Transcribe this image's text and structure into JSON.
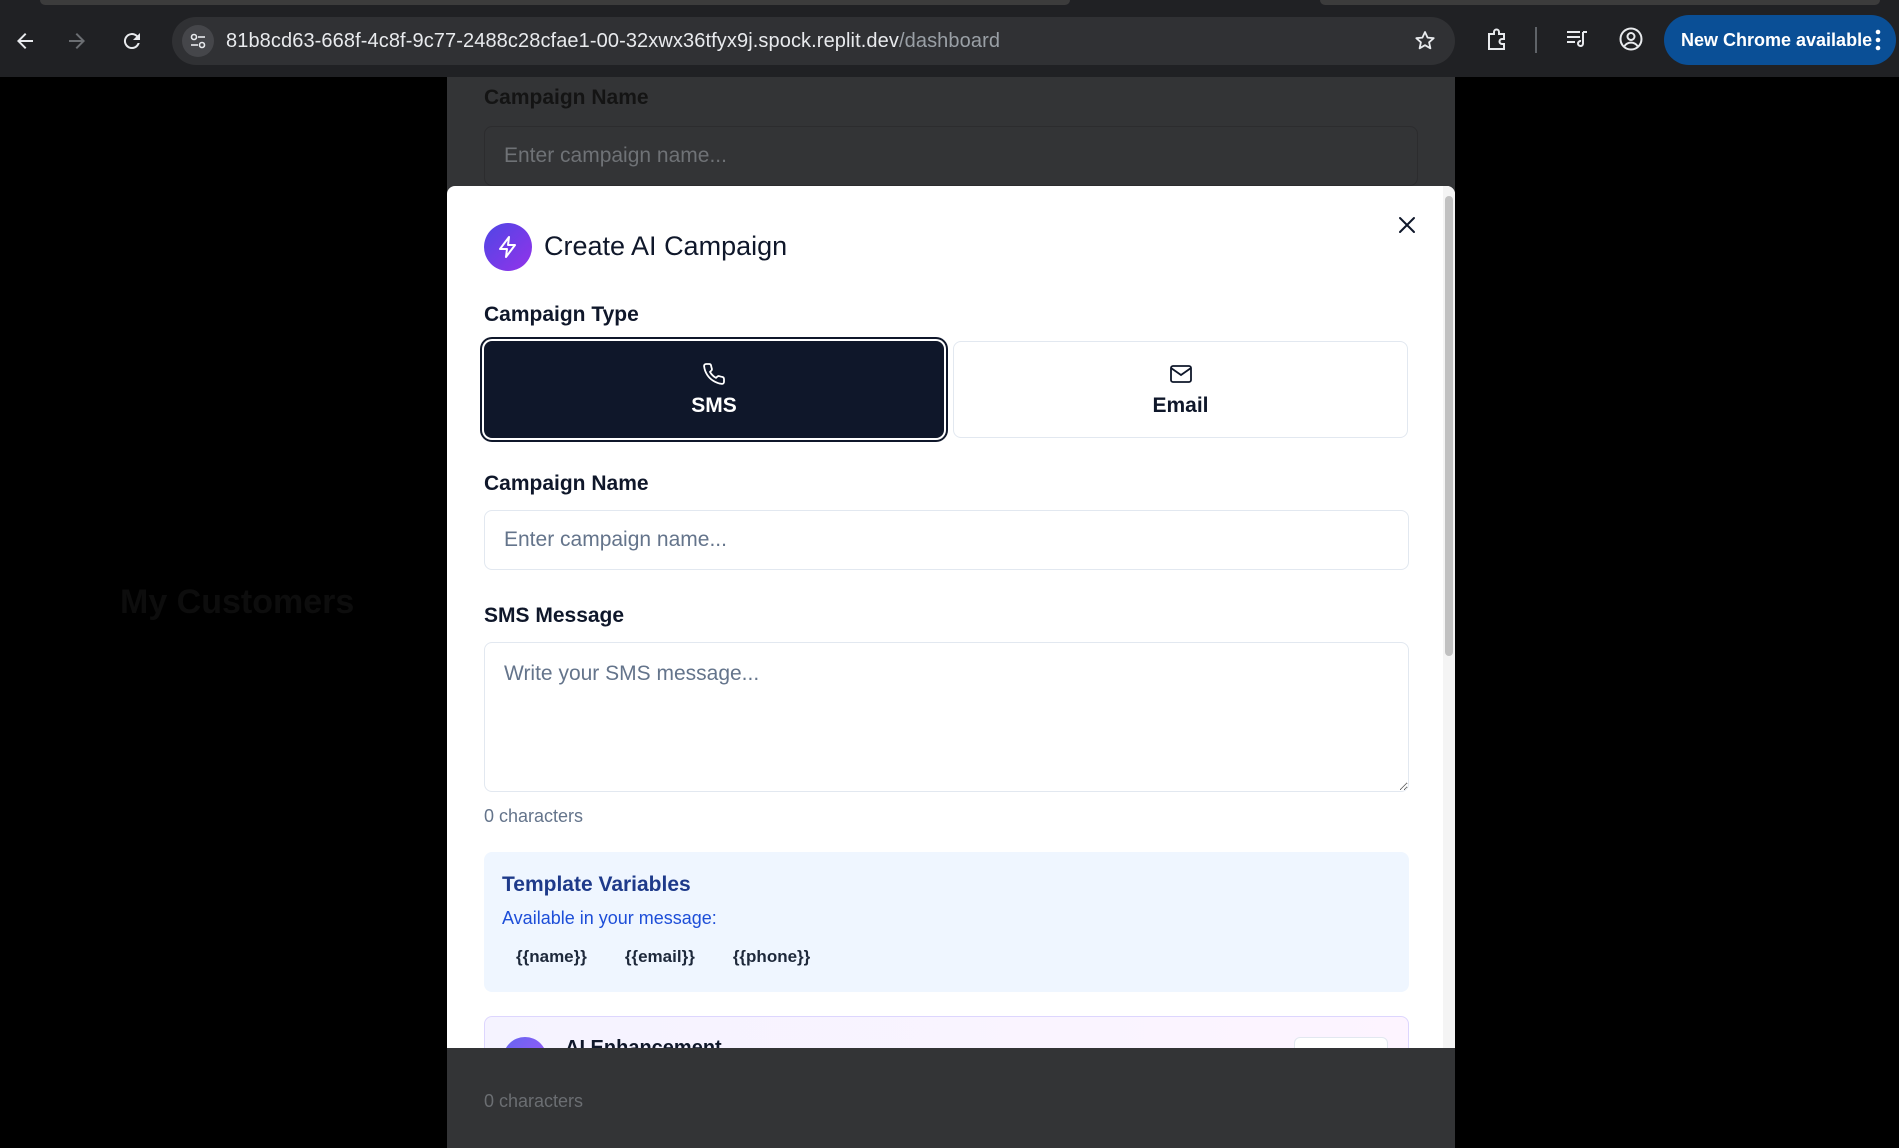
{
  "browser": {
    "url_host": "81b8cd63-668f-4c8f-9c77-2488c28cfae1-00-32xwx36tfyx9j.spock.replit.dev",
    "url_path": "/dashboard",
    "update_label": "New Chrome available"
  },
  "background": {
    "campaign_name_label": "Campaign Name",
    "campaign_name_placeholder": "Enter campaign name...",
    "chars": "0 characters",
    "ghost_customers": "My Customers"
  },
  "modal": {
    "title": "Create AI Campaign",
    "campaign_type_label": "Campaign Type",
    "types": [
      {
        "label": "SMS",
        "icon": "phone-icon",
        "selected": true
      },
      {
        "label": "Email",
        "icon": "mail-icon",
        "selected": false
      }
    ],
    "campaign_name_label": "Campaign Name",
    "campaign_name_placeholder": "Enter campaign name...",
    "sms_message_label": "SMS Message",
    "sms_message_placeholder": "Write your SMS message...",
    "char_count": "0 characters",
    "template_vars": {
      "title": "Template Variables",
      "subtitle": "Available in your message:",
      "vars": [
        "{{name}}",
        "{{email}}",
        "{{phone}}"
      ]
    },
    "ai_enhancement": {
      "title": "AI Enhancement"
    }
  },
  "colors": {
    "primary": "#0f172a",
    "brand_gradient_start": "#4f46e5",
    "brand_gradient_end": "#9333ea",
    "vars_bg": "#eff6ff",
    "update_pill": "#0a4f96"
  }
}
